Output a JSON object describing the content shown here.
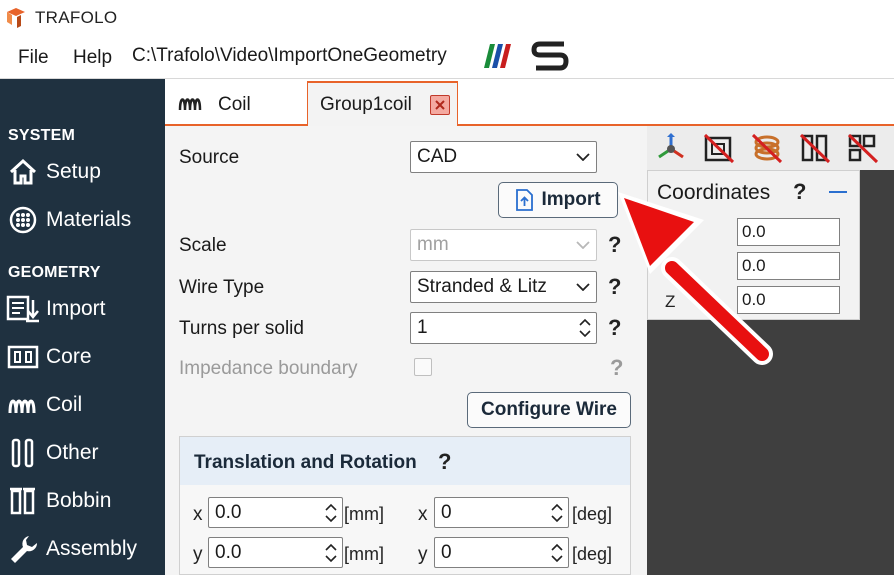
{
  "app": {
    "title": "TRAFOLO"
  },
  "menu": {
    "file": "File",
    "help": "Help",
    "path": "C:\\Trafolo\\Video\\ImportOneGeometry"
  },
  "sidebar": {
    "system_label": "SYSTEM",
    "geometry_label": "GEOMETRY",
    "items": [
      {
        "label": "Setup",
        "icon": "home-icon"
      },
      {
        "label": "Materials",
        "icon": "materials-icon"
      },
      {
        "label": "Import",
        "icon": "import-icon"
      },
      {
        "label": "Core",
        "icon": "core-icon"
      },
      {
        "label": "Coil",
        "icon": "coil-icon"
      },
      {
        "label": "Other",
        "icon": "other-icon"
      },
      {
        "label": "Bobbin",
        "icon": "bobbin-icon"
      },
      {
        "label": "Assembly",
        "icon": "wrench-icon"
      }
    ]
  },
  "tabs": [
    {
      "label": "Coil",
      "icon": "coil-icon"
    },
    {
      "label": "Group1coil",
      "active": true
    }
  ],
  "form": {
    "source_label": "Source",
    "source_value": "CAD",
    "import_label": "Import",
    "scale_label": "Scale",
    "scale_value": "mm",
    "wire_type_label": "Wire Type",
    "wire_type_value": "Stranded & Litz",
    "turns_label": "Turns per solid",
    "turns_value": "1",
    "impedance_label": "Impedance boundary",
    "impedance_checked": false,
    "configure_wire_label": "Configure Wire",
    "help": "?"
  },
  "translation": {
    "title": "Translation and Rotation",
    "help": "?",
    "rows": [
      {
        "axis_t": "x",
        "t_value": "0.0",
        "t_unit": "[mm]",
        "axis_r": "x",
        "r_value": "0",
        "r_unit": "[deg]"
      },
      {
        "axis_t": "y",
        "t_value": "0.0",
        "t_unit": "[mm]",
        "axis_r": "y",
        "r_value": "0",
        "r_unit": "[deg]"
      }
    ]
  },
  "coordinates": {
    "title": "Coordinates",
    "help": "?",
    "rows": [
      {
        "label": "",
        "value": "0.0"
      },
      {
        "label": "",
        "value": "0.0"
      },
      {
        "label": "Z",
        "value": "0.0"
      }
    ]
  },
  "colors": {
    "sidebar_bg": "#1f3140",
    "accent": "#e8632a",
    "annotation_arrow": "#e81010"
  }
}
